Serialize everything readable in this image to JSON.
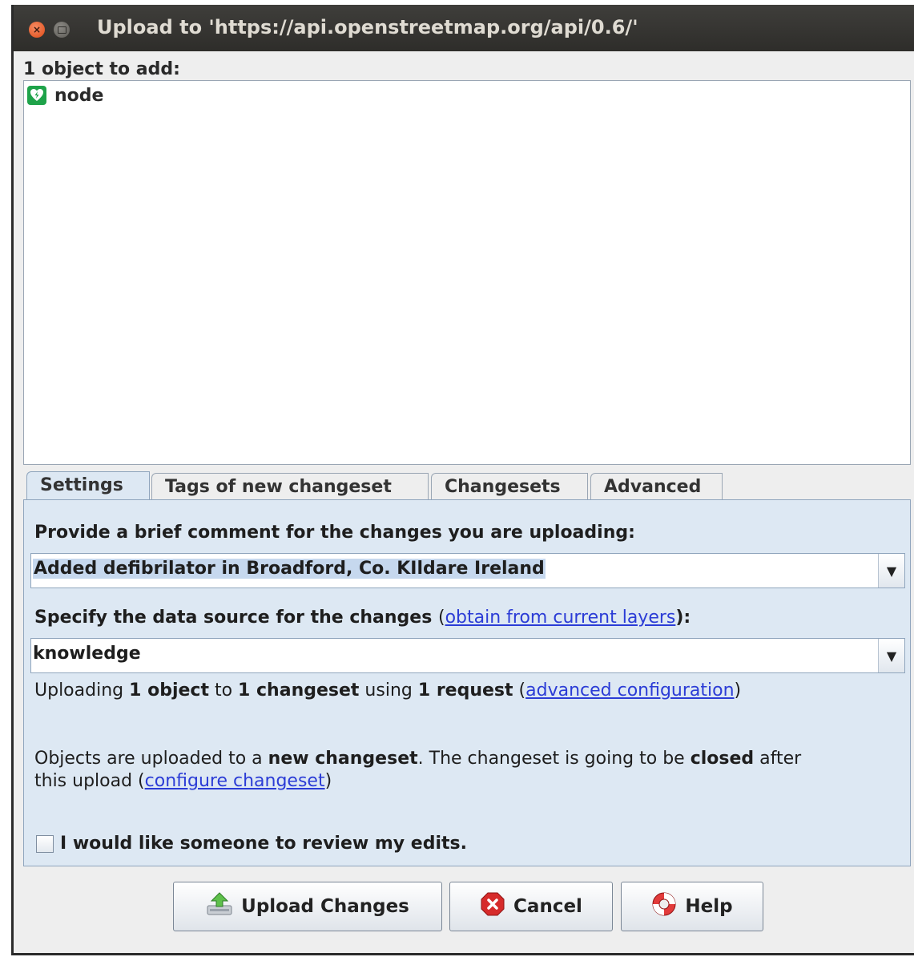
{
  "window": {
    "title": "Upload to 'https://api.openstreetmap.org/api/0.6/'"
  },
  "objects": {
    "header": "1 object to add:",
    "items": [
      {
        "label": "node",
        "icon": "defibrillator-icon"
      }
    ]
  },
  "tabs": [
    {
      "label": "Settings",
      "active": true
    },
    {
      "label": "Tags of new changeset",
      "active": false
    },
    {
      "label": "Changesets",
      "active": false
    },
    {
      "label": "Advanced",
      "active": false
    }
  ],
  "settings": {
    "comment_label": "Provide a brief comment for the changes you are uploading:",
    "comment_value": "Added defibrilator in Broadford, Co. KIldare Ireland",
    "source_label": "Specify the data source for the changes",
    "source_link_open": "(",
    "source_link": "obtain from current layers",
    "source_link_close": "):",
    "source_value": "knowledge",
    "upload_info": {
      "t1": "Uploading ",
      "b1": "1 object",
      "t2": " to ",
      "b2": "1 changeset",
      "t3": " using ",
      "b3": "1 request",
      "t4": " (",
      "link": "advanced configuration",
      "t5": ")"
    },
    "changeset_info": {
      "t1": "Objects are uploaded to a ",
      "b1": "new changeset",
      "t2": ". The changeset is going to be ",
      "b2": "closed",
      "t3": " after",
      "t4": "this upload (",
      "link": "configure changeset",
      "t5": ")"
    },
    "review_label": "I would like someone to review my edits.",
    "review_checked": false
  },
  "buttons": {
    "upload": "Upload Changes",
    "cancel": "Cancel",
    "help": "Help"
  },
  "colors": {
    "panel_bg": "#dde8f3",
    "link": "#2b3cd6",
    "title_bar": "#3a3935"
  }
}
